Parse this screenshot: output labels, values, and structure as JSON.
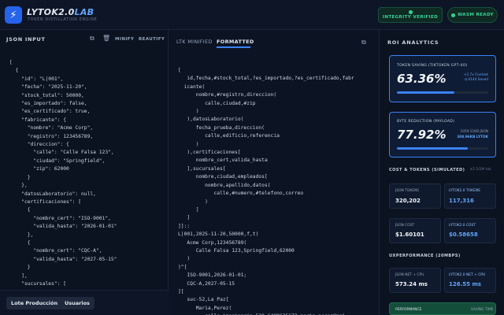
{
  "header": {
    "brand_main": "LYTOK2.0",
    "brand_accent": "LAB",
    "subtitle": "TOKEN DISTILLATION ENGINE",
    "integrity_label": "INTEGRITY VERIFIED",
    "wasm_label": "WASM READY"
  },
  "left": {
    "title": "JSON INPUT",
    "minify_label": "MINIFY",
    "beautify_label": "BEAUTIFY",
    "code": "[\n  {\n    \"id\": \"L|001\",\n    \"fecha\": \"2025-11-20\",\n    \"stock_total\": 50000,\n    \"es_importado\": false,\n    \"es_certificado\": true,\n    \"fabricante\": {\n      \"nombre\": \"Acme Corp\",\n      \"registro\": 123456789,\n      \"direccion\": {\n        \"calle\": \"Calle Falsa 123\",\n        \"ciudad\": \"Springfield\",\n        \"zip\": 62000\n      }\n    },\n    \"datosLaboratorio\": null,\n    \"certificaciones\": [\n      {\n        \"nombre_cert\": \"ISO-9001\",\n        \"valida_hasta\": \"2026-01-01\"\n      },\n      {\n        \"nombre_cert\": \"CQC-A\",\n        \"valida_hasta\": \"2027-05-15\"\n      }\n    ],\n    \"sucursales\": [",
    "tabs": [
      "Lote Producción",
      "Usuarios"
    ]
  },
  "mid": {
    "tab_minified": "LTK MINIFIED",
    "tab_formatted": "FORMATTED",
    "code": "[\n   id,fecha,#stock_total,?es_importado,?es_certificado,fabr\n  icante(\n      nombre,#registro,direccion(\n         calle,ciudad,#zip\n      )\n   ),datosLaboratorio(\n      fecha_prueba,direccion(\n         calle,edificio,referencia\n      )\n   ),certificaciones[\n      nombre_cert,valida_hasta\n   ],sucursales[\n      nombre,ciudad,empleados[\n         nombre,apellido,datos(\n            calle,#numero,#telefono,correo\n         )\n      ]\n   ]\n]]::\nL|001,2025-11-20,50000,f,t(\n   Acme Corp,123456789(\n      Calle Falsa 123,Springfield,62000\n   )\n)^[\n   ISO-9001,2026-01-01;\n   CQC-A,2027-05-15\n][\n   suc-52,La Paz[\n      Maria,Perez(\n         calle imaginaria,520,6489635672,maria.perez@mai"
  },
  "right": {
    "title": "ROI ANALYTICS",
    "token_card": {
      "label": "TOKEN SAVING (TIKTOKEN GPT-4O)",
      "value": "63.36%",
      "note1": "+2.7x Context",
      "note2": "-$.0144 Saved",
      "progress": 0.63
    },
    "byte_card": {
      "label": "BYTE REDUCTION (PAYLOAD)",
      "value": "77.92%",
      "note1": "1059.51KB JSON",
      "note2": "308.96KB LYTOK",
      "progress": 0.78
    },
    "cost_title": "COST & TOKENS (SIMULATED)",
    "cost_sub": "$1.5/1M tok",
    "cost_cells": [
      {
        "label": "JSON TOKENS",
        "value": "320,202",
        "blue": false
      },
      {
        "label": "LYTOK2.0 TOKENS",
        "value": "117,316",
        "blue": true
      },
      {
        "label": "JSON COST",
        "value": "$1.60101",
        "blue": false
      },
      {
        "label": "LYTOK2.0 COST",
        "value": "$0.58658",
        "blue": true
      }
    ],
    "perf_title": "UXPERFORMANCE (20MBPS)",
    "perf_cells": [
      {
        "label": "JSON NET + CPU",
        "value": "573.24 ms",
        "blue": false
      },
      {
        "label": "LYTOK2.0 NET + CPU",
        "value": "126.55 ms",
        "blue": true
      }
    ],
    "perf_card_label": "PERFORMANCE",
    "saving_time_label": "SAVING TIME"
  },
  "colors": {
    "accent": "#3b82f6",
    "success": "#34d399",
    "background": "#0b1220"
  }
}
